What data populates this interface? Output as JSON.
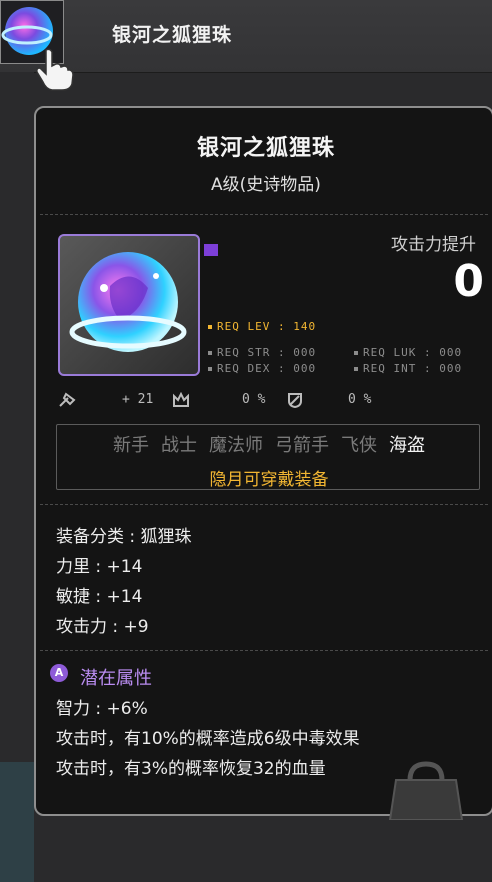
{
  "header": {
    "title": "银河之狐狸珠"
  },
  "item": {
    "name": "银河之狐狸珠",
    "grade": "A级(史诗物品)",
    "attack_up_label": "攻击力提升",
    "attack_up_value": "0",
    "req": {
      "lev": "REQ LEV : 140",
      "str": "REQ STR : 000",
      "luk": "REQ LUK : 000",
      "dex": "REQ DEX : 000",
      "int": "REQ INT : 000"
    },
    "stat_row": {
      "upgrades": "+ 21",
      "boss": "0 %",
      "ignore": "0 %"
    },
    "jobs": [
      "新手",
      "战士",
      "魔法师",
      "弓箭手",
      "飞侠",
      "海盗"
    ],
    "active_job": "海盗",
    "job_note": "隐月可穿戴装备",
    "category": "装备分类 : 狐狸珠",
    "stats": [
      {
        "label": "力里",
        "value": "+14"
      },
      {
        "label": "敏捷",
        "value": "+14"
      },
      {
        "label": "攻击力",
        "value": "+9"
      }
    ],
    "potential": {
      "badge": "A",
      "title": "潜在属性",
      "lines": [
        "智力 : +6%",
        "攻击时，有10%的概率造成6级中毒效果",
        "攻击时，有3%的概率恢复32的血量"
      ]
    }
  },
  "colors": {
    "req_lev": "#f2b632",
    "job_note": "#f2b632",
    "potential": "#b98cf0",
    "icon_border": "#9a7bd8"
  }
}
